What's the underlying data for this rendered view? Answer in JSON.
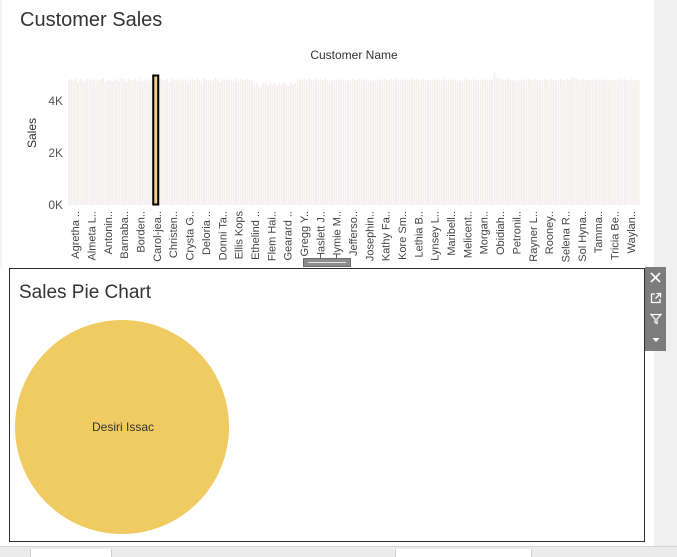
{
  "dashboard": {
    "sheets": [
      {
        "title": "Customer Sales"
      },
      {
        "title": "Sales Pie Chart"
      }
    ]
  },
  "colors": {
    "pie_fill": "#efcb62",
    "bar_fill": "#f4eeee",
    "highlight_bar_fill": "#f2cf87",
    "highlight_border": "#000000",
    "toolbar_bg": "#7d7d7d"
  },
  "toolbar": {
    "icons": [
      "close-icon",
      "pop-out-icon",
      "filter-icon",
      "more-options-icon"
    ]
  },
  "chart_data": [
    {
      "type": "bar",
      "title": "Customer Sales",
      "column_header": "Customer Name",
      "ylabel": "Sales",
      "ylim": [
        0,
        5200
      ],
      "yticks": [
        {
          "value": 0,
          "label": "0K"
        },
        {
          "value": 2000,
          "label": "2K"
        },
        {
          "value": 4000,
          "label": "4K"
        }
      ],
      "highlighted_bar_index": 38,
      "category_labels": [
        "Agretha ..",
        "Almeta L..",
        "Antonin..",
        "Barnaba..",
        "Borden..",
        "Carol-jea..",
        "Christen..",
        "Crysta G..",
        "Deloria ..",
        "Donni Ta..",
        "Ellis Kops",
        "Ethelind ..",
        "Flem Hai..",
        "Gearard ..",
        "Gregg Y..",
        "Haslett J..",
        "Hymie M..",
        "Jefferso..",
        "Josephin..",
        "Kathy Fa..",
        "Kore Sm..",
        "Lethia B..",
        "Lynsey L..",
        "Maribell..",
        "Melicent..",
        "Morgan..",
        "Obidiah..",
        "Petronil..",
        "Rayner L..",
        "Rooney..",
        "Selena R..",
        "Sol Hyna..",
        "Tamma..",
        "Tricia Be..",
        "Waylan.."
      ],
      "values": [
        4800,
        4850,
        4780,
        4900,
        4720,
        4860,
        4810,
        4750,
        4880,
        4830,
        4790,
        4870,
        4760,
        4840,
        4820,
        4890,
        4740,
        4850,
        4800,
        4780,
        4860,
        4810,
        4770,
        4890,
        4830,
        4750,
        4870,
        4820,
        4790,
        4840,
        4800,
        4860,
        4780,
        4810,
        4850,
        4770,
        4830,
        4880,
        4800,
        4760,
        4890,
        4820,
        4790,
        4850,
        4740,
        4870,
        4810,
        4830,
        4780,
        4860,
        4800,
        4840,
        4770,
        4820,
        4880,
        4790,
        4850,
        4810,
        4760,
        4870,
        4830,
        4800,
        4840,
        4780,
        4890,
        4820,
        4750,
        4860,
        4810,
        4830,
        4790,
        4850,
        4800,
        4870,
        4770,
        4840,
        4820,
        4780,
        4860,
        4810,
        4830,
        4650,
        4700,
        4600,
        4550,
        4720,
        4680,
        4610,
        4750,
        4640,
        4700,
        4580,
        4690,
        4620,
        4730,
        4660,
        4590,
        4710,
        4650,
        4680,
        4800,
        4850,
        4820,
        4900,
        4780,
        4860,
        4830,
        4790,
        4870,
        4810,
        4840,
        4800,
        4880,
        4820,
        4770,
        4850,
        4810,
        4830,
        4790,
        4860,
        4820,
        4800,
        4840,
        4780,
        4870,
        4810,
        4830,
        4850,
        4790,
        4820,
        4860,
        4800,
        4840,
        4770,
        4830,
        4810,
        4850,
        4790,
        4870,
        4820,
        4800,
        4840,
        4780,
        4860,
        4810,
        4830,
        4790,
        4850,
        4820,
        4800,
        4870,
        4810,
        4840,
        4780,
        4830,
        4860,
        4800,
        4820,
        4790,
        4850,
        4810,
        4840,
        4820,
        4800,
        4860,
        4790,
        4830,
        4850,
        4810,
        4820,
        4780,
        4840,
        4800,
        4870,
        4810,
        4830,
        4790,
        4860,
        4820,
        4800,
        4840,
        4810,
        4850,
        4790,
        4830,
        4820,
        5100,
        4900,
        4850,
        4870,
        4830,
        4800,
        4860,
        4820,
        4840,
        4800,
        4780,
        4830,
        4810,
        4850,
        4800,
        4840,
        4820,
        4790,
        4860,
        4810,
        4830,
        4800,
        4850,
        4820,
        4780,
        4840,
        4810,
        4830,
        4800,
        4860,
        4820,
        4790,
        4850,
        4810,
        4950,
        4900,
        4870,
        4830,
        4810,
        4850,
        4800,
        4840,
        4820,
        4790,
        4860,
        4810,
        4830,
        4800,
        4850,
        4820,
        4780,
        4840,
        4810,
        4830,
        4800,
        4860,
        4820,
        4850,
        4810,
        4790,
        4830,
        4800,
        4840,
        4820
      ]
    },
    {
      "type": "pie",
      "title": "Sales Pie Chart",
      "slices": [
        {
          "label": "Desiri Issac",
          "value": 1
        }
      ]
    }
  ]
}
